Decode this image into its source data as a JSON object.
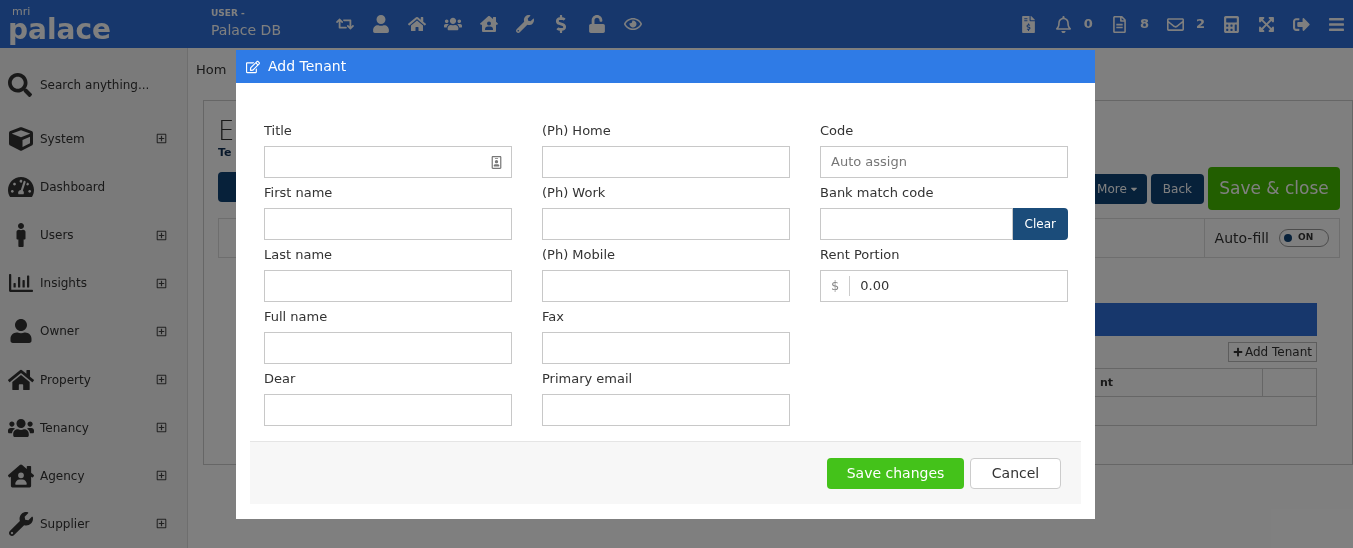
{
  "top_bar": {
    "logo_small": "mri",
    "logo": "palace",
    "user_label": "USER -",
    "database": "Palace DB",
    "counts": [
      {
        "count": "0"
      },
      {
        "count": "8"
      },
      {
        "count": "2"
      }
    ]
  },
  "sidebar": {
    "search_placeholder": "Search anything...",
    "items": [
      {
        "label": "System",
        "expandable": true
      },
      {
        "label": "Dashboard",
        "expandable": false
      },
      {
        "label": "Users",
        "expandable": true
      },
      {
        "label": "Insights",
        "expandable": true
      },
      {
        "label": "Owner",
        "expandable": true
      },
      {
        "label": "Property",
        "expandable": true
      },
      {
        "label": "Tenancy",
        "expandable": true
      },
      {
        "label": "Agency",
        "expandable": true
      },
      {
        "label": "Supplier",
        "expandable": true
      }
    ]
  },
  "page": {
    "breadcrumb": "Hom",
    "title": "E",
    "subtitle": "Te",
    "buttons": [
      "More",
      "Back"
    ],
    "save_close": "Save & close",
    "autofill": {
      "label": "Auto-fill",
      "state": "ON",
      "on": true
    },
    "add_tenant": "Add Tenant",
    "table_header": "nt"
  },
  "modal": {
    "title": "Add Tenant",
    "columns": [
      [
        {
          "label": "Title",
          "kind": "icon"
        },
        {
          "label": "First name",
          "kind": "text"
        },
        {
          "label": "Last name",
          "kind": "text"
        },
        {
          "label": "Full name",
          "kind": "text"
        },
        {
          "label": "Dear",
          "kind": "text"
        }
      ],
      [
        {
          "label": "(Ph) Home",
          "kind": "text"
        },
        {
          "label": "(Ph) Work",
          "kind": "text"
        },
        {
          "label": "(Ph) Mobile",
          "kind": "text"
        },
        {
          "label": "Fax",
          "kind": "text"
        },
        {
          "label": "Primary email",
          "kind": "text"
        }
      ],
      [
        {
          "label": "Code",
          "kind": "text",
          "placeholder": "Auto assign"
        },
        {
          "label": "Bank match code",
          "kind": "button",
          "button": "Clear"
        },
        {
          "label": "Rent Portion",
          "kind": "currency",
          "prefix": "$",
          "value": "0.00"
        }
      ]
    ],
    "save": "Save changes",
    "cancel": "Cancel"
  }
}
